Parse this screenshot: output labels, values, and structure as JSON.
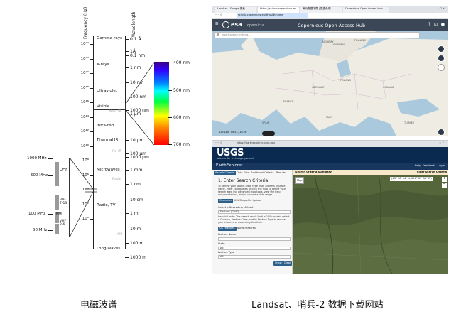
{
  "spectrum": {
    "axis_titles": {
      "frequency": "Frequency (Hz)",
      "wavelength": "Wavelength"
    },
    "frequency_ticks": [
      "10²⁴",
      "10²²",
      "10²⁰",
      "10¹⁸",
      "10¹⁶",
      "10¹⁴",
      "10¹²",
      "10¹⁰",
      "10⁸",
      "10⁶",
      "10⁴",
      "10²",
      "10⁰"
    ],
    "wavelength_ticks": [
      "0.1 Å",
      "1Å",
      "0.1 nm",
      "1 nm",
      "10 nm",
      "100 nm",
      "1000 nm",
      "1 µm",
      "10 µm",
      "100 µm",
      "1000 µm",
      "1 mm",
      "1 cm",
      "10 cm",
      "1 m",
      "10 m",
      "100 m",
      "1000 m"
    ],
    "bands": [
      "Gamma-rays",
      "X-rays",
      "Ultraviolet",
      "Visible",
      "Near IR",
      "Infra-red",
      "Thermal IR",
      "Far IR",
      "Microwaves",
      "Radar",
      "Radio, TV",
      "AM",
      "Long-waves"
    ],
    "visible_wavelengths": [
      "400 nm",
      "500 nm",
      "600 nm",
      "700 nm"
    ],
    "zoom_frequency_labels": [
      "1000 MHz",
      "500 MHz",
      "100 MHz",
      "50 MHz"
    ],
    "zoom_band_labels": [
      "UHF",
      "VHF 7-13",
      "FM",
      "VHF 2-6"
    ],
    "caption": "电磁波谱"
  },
  "copernicus": {
    "tabs": [
      "Landsat - Google 搜索",
      "https://scihub.copernicus.eu",
      "哨兵数据下载 | 数据处理",
      "Copernicus Open Access Hub"
    ],
    "url": "scihub.copernicus.eu/dhus/#/home",
    "brand": "esa",
    "brand_sub": "opernicus",
    "title": "Copernicus Open Access Hub",
    "search_placeholder": "Insert search criteria...",
    "status": "Lat Lon: 54.51, 16.26",
    "map_labels": [
      "FINLAND",
      "SWEDEN",
      "NORWAY",
      "POLAND",
      "UKRAINE",
      "GERMANY",
      "FRANCE",
      "SPAIN",
      "ITALY",
      "TURKEY"
    ]
  },
  "usgs": {
    "url": "https://earthexplorer.usgs.gov",
    "logo": "USGS",
    "tagline": "science for a changing world",
    "app_name": "EarthExplorer",
    "nav": [
      "Help",
      "Feedback",
      "Login"
    ],
    "side_tabs": [
      "Search Criteria",
      "Data Sets",
      "Additional Criteria",
      "Results"
    ],
    "heading": "1. Enter Search Criteria",
    "intro": "To narrow your search area: type in an address or place name, enter coordinates or click the map to define your search area (for advanced map tools, view the help documentation), and/or choose a date range.",
    "subtabs": [
      "Geocoder",
      "KML/Shapefile Upload"
    ],
    "geocode_label": "Select a Geocoding Method",
    "geocode_value": "Feature (GNIS)",
    "limits_text": "Search Limits: The search result limit is 100 records; select a Country, Feature Class, and/or Feature Type to reduce your chances of exceeding this limit.",
    "us_buttons": [
      "US Features",
      "World Features"
    ],
    "fields": [
      "Feature Name",
      "State",
      "Feature Type"
    ],
    "field_values": [
      "",
      "All",
      "All"
    ],
    "actions": [
      "Show",
      "Clear"
    ],
    "map_header": "Search Criteria Summary",
    "map_header_action": "Clear Search Criteria",
    "coords": "(43° 28' 54\" N, 096° 31' 33\" W)",
    "map_type": "Map"
  },
  "right_caption": "Landsat、哨兵-2 数据下载网站"
}
